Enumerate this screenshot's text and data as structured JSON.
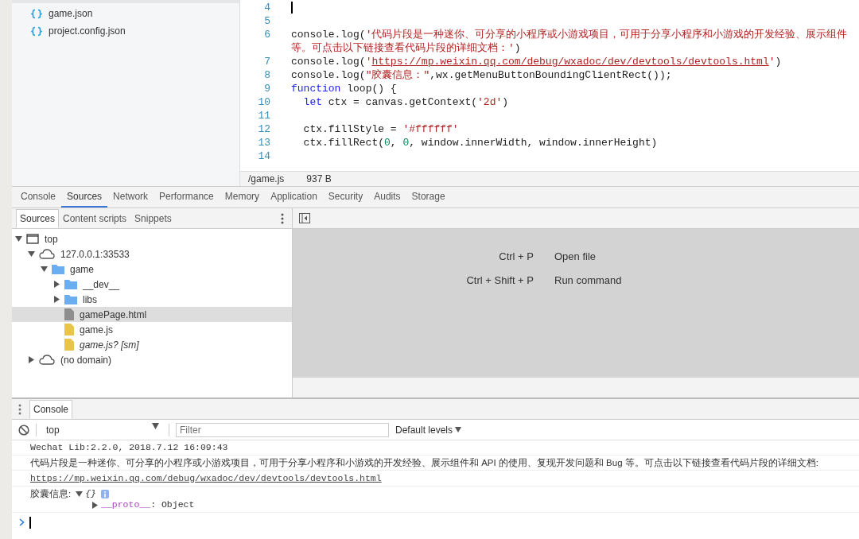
{
  "file_list": [
    {
      "name": "game.json",
      "kind": "json"
    },
    {
      "name": "project.config.json",
      "kind": "json"
    }
  ],
  "editor": {
    "lines": [
      {
        "number": "4",
        "cursor": true
      },
      {
        "number": "5",
        "cursor": false
      },
      {
        "number": "6",
        "cursor": false,
        "tokens": [
          {
            "kind": "plain",
            "text": "console.log("
          },
          {
            "kind": "string",
            "text": "'代码片段是一种迷你、可分享的小程序或小游戏项目，可用于分享小程序和小游戏的开发经验、展示组件"
          }
        ]
      },
      {
        "cursor": false,
        "tokens": [
          {
            "kind": "string",
            "text": "等。可点击以下链接查看代码片段的详细文档：'"
          },
          {
            "kind": "plain",
            "text": ")"
          }
        ]
      },
      {
        "number": "7",
        "cursor": false,
        "tokens": [
          {
            "kind": "plain",
            "text": "console.log("
          },
          {
            "kind": "string",
            "text": "'"
          },
          {
            "kind": "url",
            "text": "https://mp.weixin.qq.com/debug/wxadoc/dev/devtools/devtools.html"
          },
          {
            "kind": "string",
            "text": "'"
          },
          {
            "kind": "plain",
            "text": ")"
          }
        ]
      },
      {
        "number": "8",
        "cursor": false,
        "tokens": [
          {
            "kind": "plain",
            "text": "console.log("
          },
          {
            "kind": "string",
            "text": "\"胶囊信息：\""
          },
          {
            "kind": "plain",
            "text": ",wx.getMenuButtonBoundingClientRect());"
          }
        ]
      },
      {
        "number": "9",
        "cursor": false,
        "tokens": [
          {
            "kind": "keyword",
            "text": "function"
          },
          {
            "kind": "plain",
            "text": " loop() {"
          }
        ]
      },
      {
        "number": "10",
        "cursor": false,
        "tokens": [
          {
            "kind": "keyword",
            "text": "  let"
          },
          {
            "kind": "plain",
            "text": " ctx = canvas.getContext("
          },
          {
            "kind": "string",
            "text": "'2d'"
          },
          {
            "kind": "plain",
            "text": ")"
          }
        ]
      },
      {
        "number": "11",
        "cursor": false
      },
      {
        "number": "12",
        "cursor": false,
        "tokens": [
          {
            "kind": "plain",
            "text": "  ctx.fillStyle = "
          },
          {
            "kind": "string",
            "text": "'#ffffff'"
          }
        ]
      },
      {
        "number": "13",
        "cursor": false,
        "tokens": [
          {
            "kind": "plain",
            "text": "  ctx.fillRect("
          },
          {
            "kind": "number",
            "text": "0"
          },
          {
            "kind": "plain",
            "text": ", "
          },
          {
            "kind": "number",
            "text": "0"
          },
          {
            "kind": "plain",
            "text": ", window.innerWidth, window.innerHeight)"
          }
        ]
      },
      {
        "number": "14",
        "cursor": false
      }
    ],
    "status": {
      "file": "/game.js",
      "size": "937 B"
    }
  },
  "tabs": [
    {
      "label": "Console",
      "selected": false
    },
    {
      "label": "Sources",
      "selected": true
    },
    {
      "label": "Network",
      "selected": false
    },
    {
      "label": "Performance",
      "selected": false
    },
    {
      "label": "Memory",
      "selected": false
    },
    {
      "label": "Application",
      "selected": false
    },
    {
      "label": "Security",
      "selected": false
    },
    {
      "label": "Audits",
      "selected": false
    },
    {
      "label": "Storage",
      "selected": false
    }
  ],
  "sources": {
    "subtabs": [
      {
        "label": "Sources",
        "selected": true
      },
      {
        "label": "Content scripts",
        "selected": false
      },
      {
        "label": "Snippets",
        "selected": false
      }
    ],
    "tree": [
      {
        "label": "top",
        "kind": "frame",
        "expanded": true,
        "selected": false,
        "children": [
          {
            "label": "127.0.0.1:33533",
            "kind": "domain",
            "expanded": true,
            "selected": false,
            "children": [
              {
                "label": "game",
                "kind": "folder",
                "expanded": true,
                "selected": false,
                "children": [
                  {
                    "label": "__dev__",
                    "kind": "folder",
                    "expanded": false,
                    "selected": false
                  },
                  {
                    "label": "libs",
                    "kind": "folder",
                    "expanded": false,
                    "selected": false
                  },
                  {
                    "label": "gamePage.html",
                    "kind": "document",
                    "selected": true
                  },
                  {
                    "label": "game.js",
                    "kind": "script",
                    "selected": false
                  },
                  {
                    "label": "game.js? [sm]",
                    "kind": "sourcemap",
                    "selected": false
                  }
                ]
              }
            ]
          },
          {
            "label": "(no domain)",
            "kind": "domain",
            "expanded": false,
            "selected": false
          }
        ]
      }
    ],
    "shortcuts": [
      {
        "keys": "Ctrl + P",
        "action": "Open file"
      },
      {
        "keys": "Ctrl + Shift + P",
        "action": "Run command"
      }
    ]
  },
  "drawer": {
    "tabs": [
      {
        "label": "Console",
        "selected": true
      }
    ],
    "context": "top",
    "filter_placeholder": "Filter",
    "levels": "Default levels",
    "messages": [
      {
        "kind": "log",
        "text": "Wechat Lib:2.2.0, 2018.7.12 16:09:43"
      },
      {
        "kind": "text",
        "text": "代码片段是一种迷你、可分享的小程序或小游戏项目，可用于分享小程序和小游戏的开发经验、展示组件和 API 的使用、复现开发问题和 Bug 等。可点击以下链接查看代码片段的详细文档:"
      },
      {
        "kind": "link",
        "text": "https://mp.weixin.qq.com/debug/wxadoc/dev/devtools/devtools.html"
      },
      {
        "kind": "object",
        "label": "胶囊信息:",
        "summary": "{}",
        "expanded": true,
        "children": [
          {
            "key": "__proto__",
            "separator": ":",
            "value": "Object",
            "expanded": false
          }
        ]
      }
    ]
  }
}
